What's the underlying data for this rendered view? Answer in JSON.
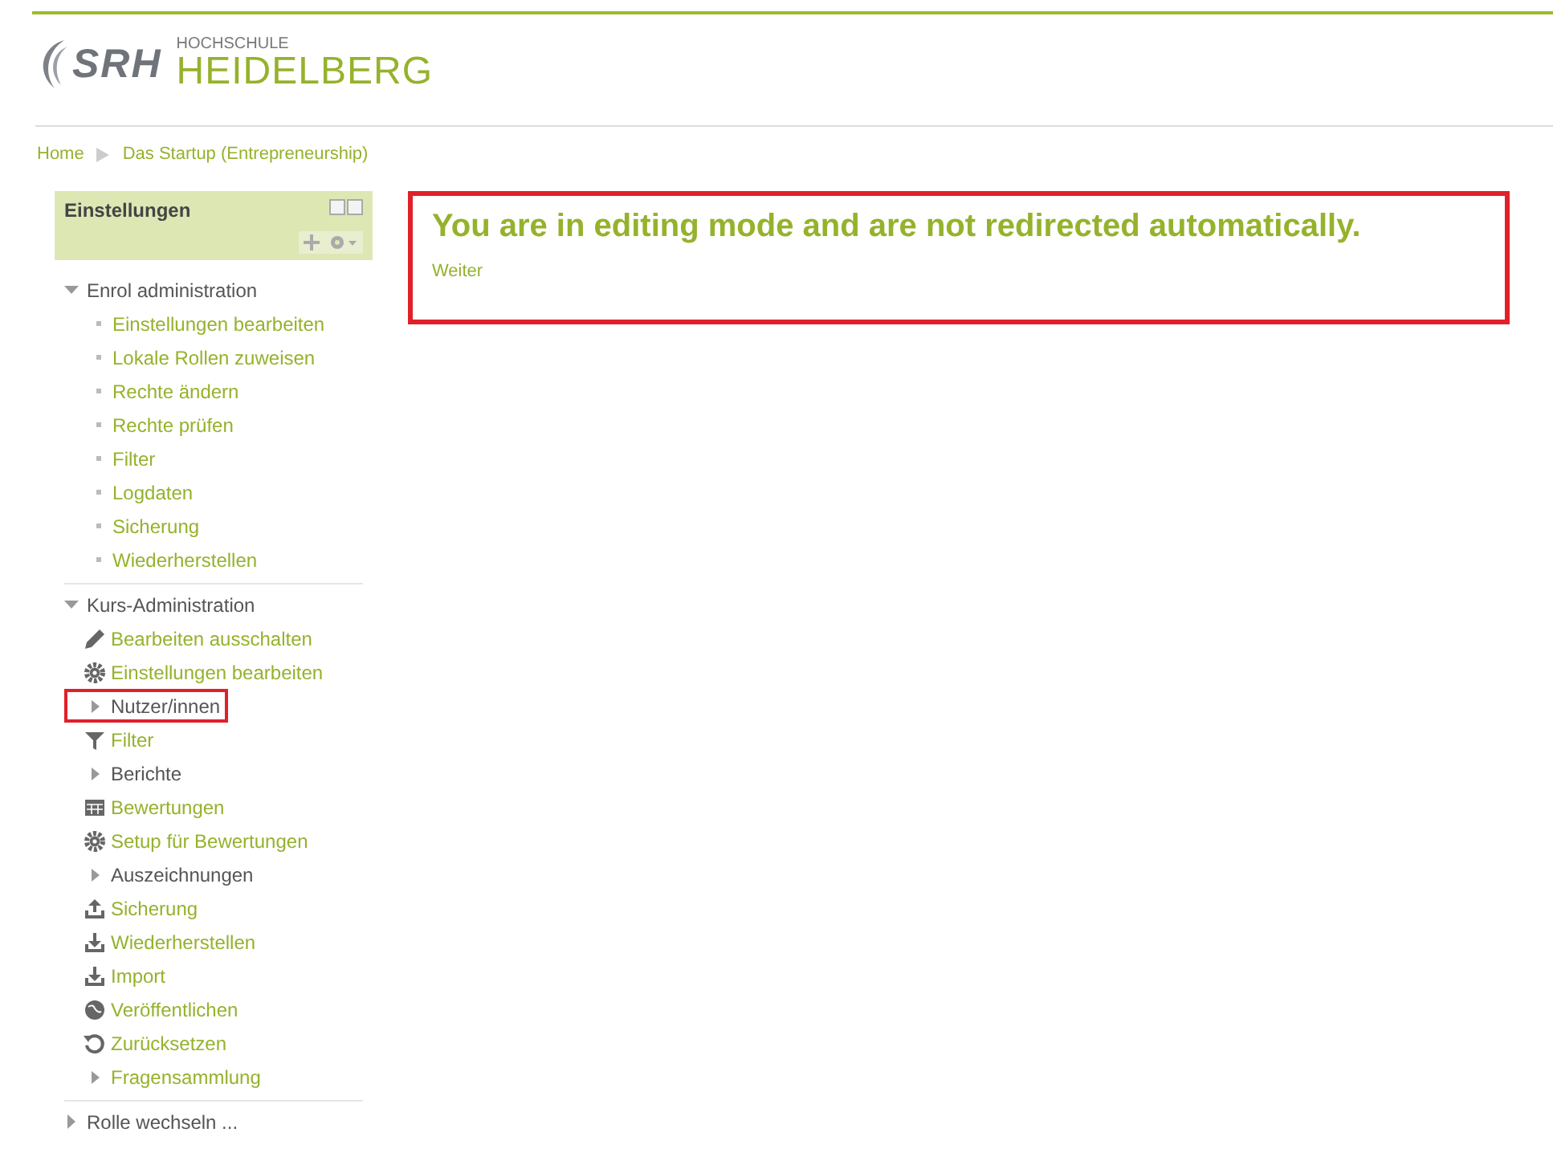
{
  "header": {
    "logo_mark": "SRH",
    "logo_small": "HOCHSCHULE",
    "logo_big": "HEIDELBERG"
  },
  "breadcrumb": [
    "Home",
    "Das Startup (Entrepreneurship)"
  ],
  "block": {
    "title": "Einstellungen",
    "sections": [
      {
        "label": "Enrol administration",
        "expanded": true,
        "items": [
          {
            "label": "Einstellungen bearbeiten",
            "kind": "bullet",
            "link": true,
            "highlighted": false
          },
          {
            "label": "Lokale Rollen zuweisen",
            "kind": "bullet",
            "link": true,
            "highlighted": false
          },
          {
            "label": "Rechte ändern",
            "kind": "bullet",
            "link": true,
            "highlighted": false
          },
          {
            "label": "Rechte prüfen",
            "kind": "bullet",
            "link": true,
            "highlighted": false
          },
          {
            "label": "Filter",
            "kind": "bullet",
            "link": true,
            "highlighted": false
          },
          {
            "label": "Logdaten",
            "kind": "bullet",
            "link": true,
            "highlighted": false
          },
          {
            "label": "Sicherung",
            "kind": "bullet",
            "link": true,
            "highlighted": false
          },
          {
            "label": "Wiederherstellen",
            "kind": "bullet",
            "link": true,
            "highlighted": false
          }
        ]
      },
      {
        "label": "Kurs-Administration",
        "expanded": true,
        "items": [
          {
            "label": "Bearbeiten ausschalten",
            "kind": "pencil",
            "link": true,
            "highlighted": false
          },
          {
            "label": "Einstellungen bearbeiten",
            "kind": "gear",
            "link": true,
            "highlighted": false
          },
          {
            "label": "Nutzer/innen",
            "kind": "caret",
            "link": false,
            "highlighted": true
          },
          {
            "label": "Filter",
            "kind": "filter",
            "link": true,
            "highlighted": false
          },
          {
            "label": "Berichte",
            "kind": "caret",
            "link": false,
            "highlighted": false
          },
          {
            "label": "Bewertungen",
            "kind": "table",
            "link": true,
            "highlighted": false
          },
          {
            "label": "Setup für Bewertungen",
            "kind": "gear",
            "link": true,
            "highlighted": false
          },
          {
            "label": "Auszeichnungen",
            "kind": "caret",
            "link": false,
            "highlighted": false
          },
          {
            "label": "Sicherung",
            "kind": "upload",
            "link": true,
            "highlighted": false
          },
          {
            "label": "Wiederherstellen",
            "kind": "download",
            "link": true,
            "highlighted": false
          },
          {
            "label": "Import",
            "kind": "download",
            "link": true,
            "highlighted": false
          },
          {
            "label": "Veröffentlichen",
            "kind": "globe",
            "link": true,
            "highlighted": false
          },
          {
            "label": "Zurücksetzen",
            "kind": "reset",
            "link": true,
            "highlighted": false
          },
          {
            "label": "Fragensammlung",
            "kind": "caret",
            "link": true,
            "highlighted": false
          }
        ]
      },
      {
        "label": "Rolle wechseln ...",
        "expanded": false
      }
    ]
  },
  "message": {
    "heading": "You are in editing mode and are not redirected automatically.",
    "link": "Weiter",
    "highlighted": true
  }
}
